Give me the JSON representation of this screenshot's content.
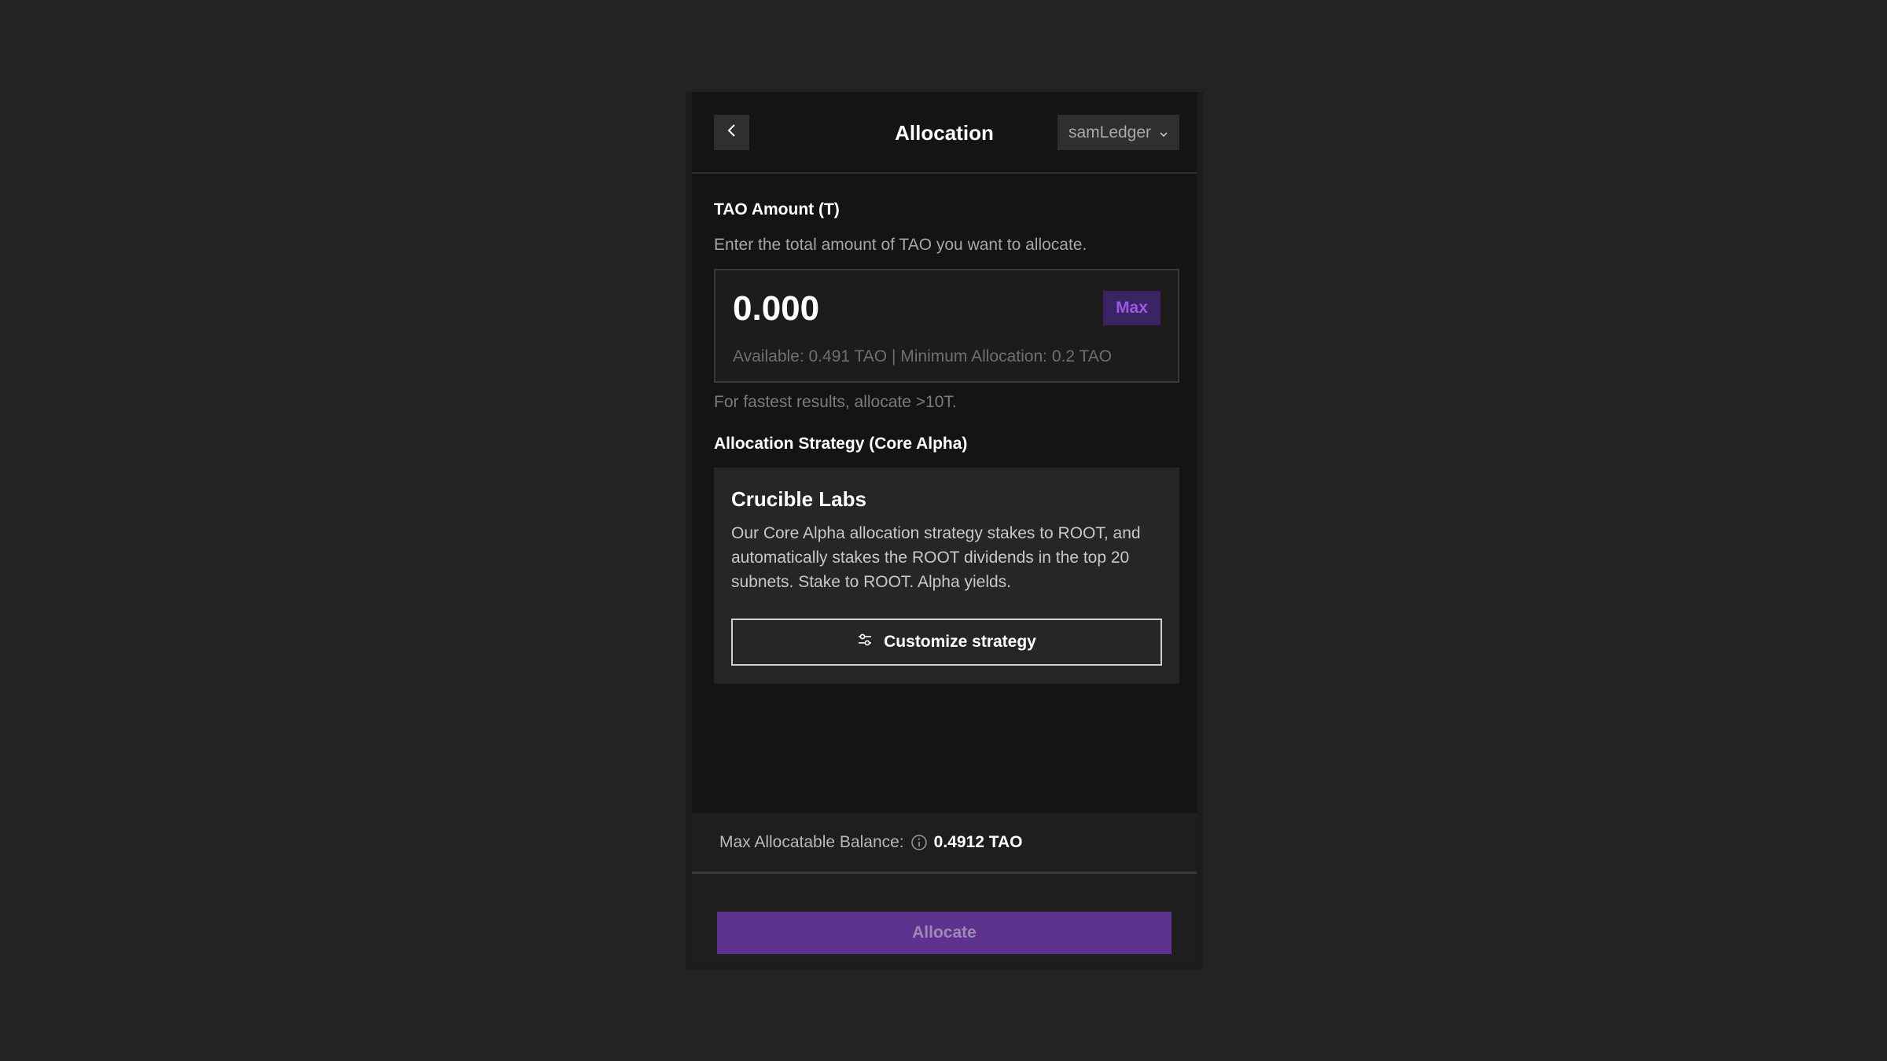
{
  "header": {
    "title": "Allocation",
    "back_icon": "chevron-left-icon",
    "account": "samLedger",
    "account_icon": "chevron-down-icon"
  },
  "amount": {
    "label": "TAO Amount (T)",
    "description": "Enter the total amount of TAO you want to allocate.",
    "value": "0.000",
    "max_label": "Max",
    "available_text": "Available: 0.491 TAO | Minimum Allocation: 0.2 TAO",
    "hint": "For fastest results, allocate >10T."
  },
  "strategy": {
    "label": "Allocation Strategy (Core Alpha)",
    "name": "Crucible Labs",
    "description": "Our Core Alpha allocation strategy stakes to ROOT, and automatically stakes the ROOT dividends in the top 20 subnets. Stake to ROOT. Alpha yields.",
    "customize_label": "Customize strategy",
    "customize_icon": "sliders-icon"
  },
  "footer": {
    "balance_label": "Max Allocatable Balance:",
    "balance_icon": "info-icon",
    "balance_value": "0.4912 TAO",
    "allocate_label": "Allocate"
  },
  "colors": {
    "accent": "#5e3390",
    "max_text": "#9b59e6",
    "background": "#232323",
    "panel": "#141414"
  }
}
